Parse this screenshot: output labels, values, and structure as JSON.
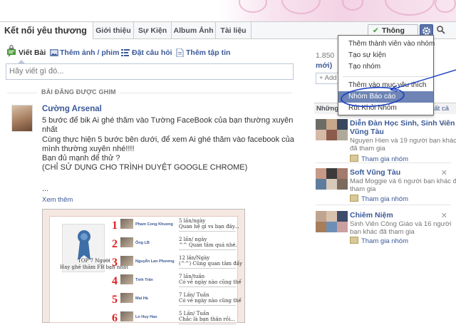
{
  "group": {
    "name": "Kết nối yêu thương"
  },
  "tabs": [
    {
      "label": "Giới thiệu"
    },
    {
      "label": "Sự Kiện"
    },
    {
      "label": "Album Ảnh"
    },
    {
      "label": "Tài liệu"
    }
  ],
  "toolbar": {
    "notifications_label": "Thông Báo"
  },
  "menu": {
    "items": [
      {
        "label": "Thêm thành viên vào nhóm"
      },
      {
        "label": "Tạo sự kiện"
      },
      {
        "label": "Tạo nhóm"
      },
      {
        "label": "Thêm vào mục yêu thích"
      },
      {
        "label": "Nhóm Báo cáo"
      },
      {
        "label": "Rút Khỏi Nhóm"
      }
    ]
  },
  "composer": {
    "post": "Viết Bài",
    "photo": "Thêm ảnh / phim",
    "question": "Đặt câu hỏi",
    "file": "Thêm tập tin",
    "placeholder": "Hãy viết gì đó..."
  },
  "pinned": {
    "label": "BÀI ĐĂNG ĐƯỢC GHIM",
    "author": "Cường Arsenal",
    "lines": [
      "5 bước để bik Ai ghé thăm vào Tường FaceBook của bạn thường xuyên",
      "nhất",
      "Cùng thực hiện 5 bước bên dưới, để xem Ai ghé thăm vào facebook của",
      "mình thường xuyên nhé!!!!",
      "Bạn đủ mạnh để thử ?",
      "(CHỈ SỬ DỤNG CHO TRÌNH DUYỆT GOOGLE CHROME)"
    ],
    "ellipsis": "...",
    "see_more": "Xem thêm"
  },
  "post_image": {
    "caption": [
      "TOP 7 Người",
      "Hay ghé thăm FB bạn nhất"
    ],
    "entries": [
      {
        "rank": "1",
        "name": "Pham Cong Khuong",
        "l1": "5 lần/ngày",
        "l2": "Quan hệ gì vs bạn đây..."
      },
      {
        "rank": "2",
        "name": "Ông LB",
        "l1": "2 lần/ ngày",
        "l2": "^^ Quan tâm quá nhé."
      },
      {
        "rank": "3",
        "name": "Nguyễn Lan Phương",
        "l1": "12 lần/Ngày",
        "l2": "(^^) Cũng quan tâm đấy"
      },
      {
        "rank": "4",
        "name": "Tình Trần",
        "l1": "7 lần/tuần",
        "l2": "Có vẻ ngày nào cũng thế"
      },
      {
        "rank": "5",
        "name": "Mai Hà",
        "l1": "7 Lần/ Tuần",
        "l2": "Có vẻ ngày nào cũng thế"
      },
      {
        "rank": "6",
        "name": "Ln Huy Hao",
        "l1": "5 Lần/ Tuần",
        "l2": "Chắc là bạn thân rồi..."
      }
    ]
  },
  "sidebar": {
    "members_count": "1.850",
    "members_suffix": "mới)",
    "add_placeholder": "+ Add",
    "header_label": "Những",
    "header_link": "tất cả",
    "groups": [
      {
        "title": "Diễn Đàn Học Sinh, Sinh Viên",
        "title2": "Vũng Tàu",
        "desc1": "Nguyen Hien và 19 người bạn khác",
        "desc2": "đã tham gia",
        "join": "Tham gia nhóm"
      },
      {
        "title": "Soft Vũng Tàu",
        "title2": "",
        "desc1": "Mad Moggie và 6 người bạn khác đã",
        "desc2": "tham gia",
        "join": "Tham gia nhóm"
      },
      {
        "title": "Chiêm Niệm",
        "title2": "",
        "desc1": "Sinh Viên Công Giáo và 16 người",
        "desc2": "bạn khác đã tham gia",
        "join": "Tham gia nhóm"
      }
    ]
  },
  "colors": {
    "accent": "#3b5998",
    "highlight": "#6d84b4",
    "annotation": "#1a3fc4"
  }
}
